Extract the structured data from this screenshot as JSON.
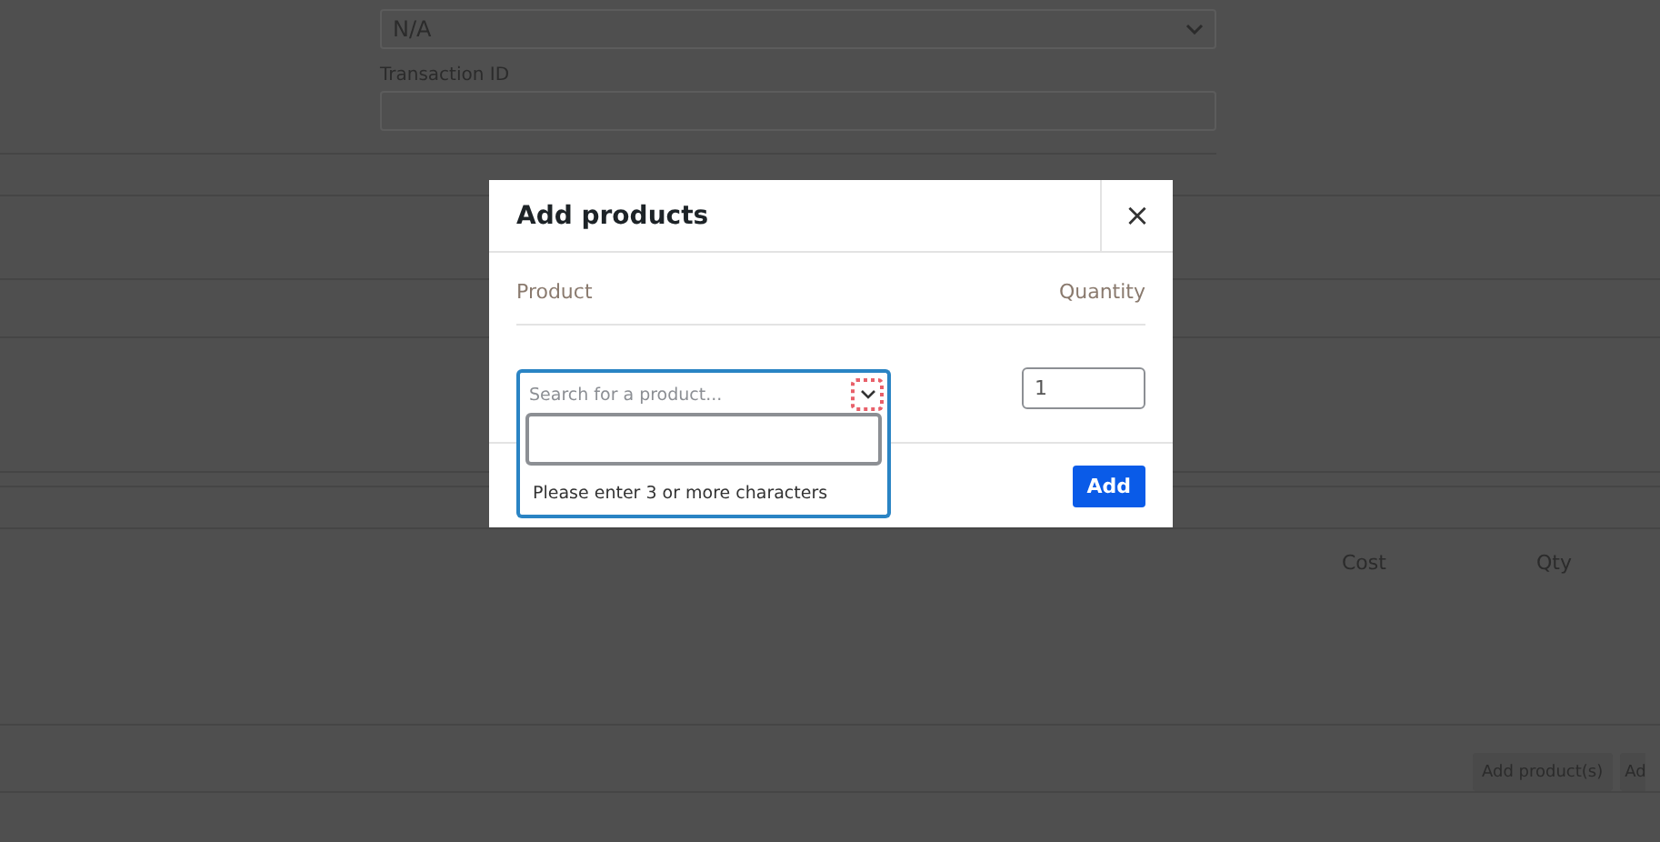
{
  "page": {
    "payment_select": {
      "value": "N/A"
    },
    "transaction_id": {
      "label": "Transaction ID"
    },
    "items_table": {
      "columns": [
        "Cost",
        "Qty"
      ]
    },
    "buttons": [
      "Add product(s)",
      "Ad"
    ]
  },
  "modal": {
    "title": "Add products",
    "close": "×",
    "columns": [
      "Product",
      "Quantity"
    ],
    "product_select": {
      "placeholder": "Search for a product...",
      "expanded": true,
      "message": "Please enter 3 or more characters"
    },
    "quantity": "1",
    "button": "Add"
  }
}
